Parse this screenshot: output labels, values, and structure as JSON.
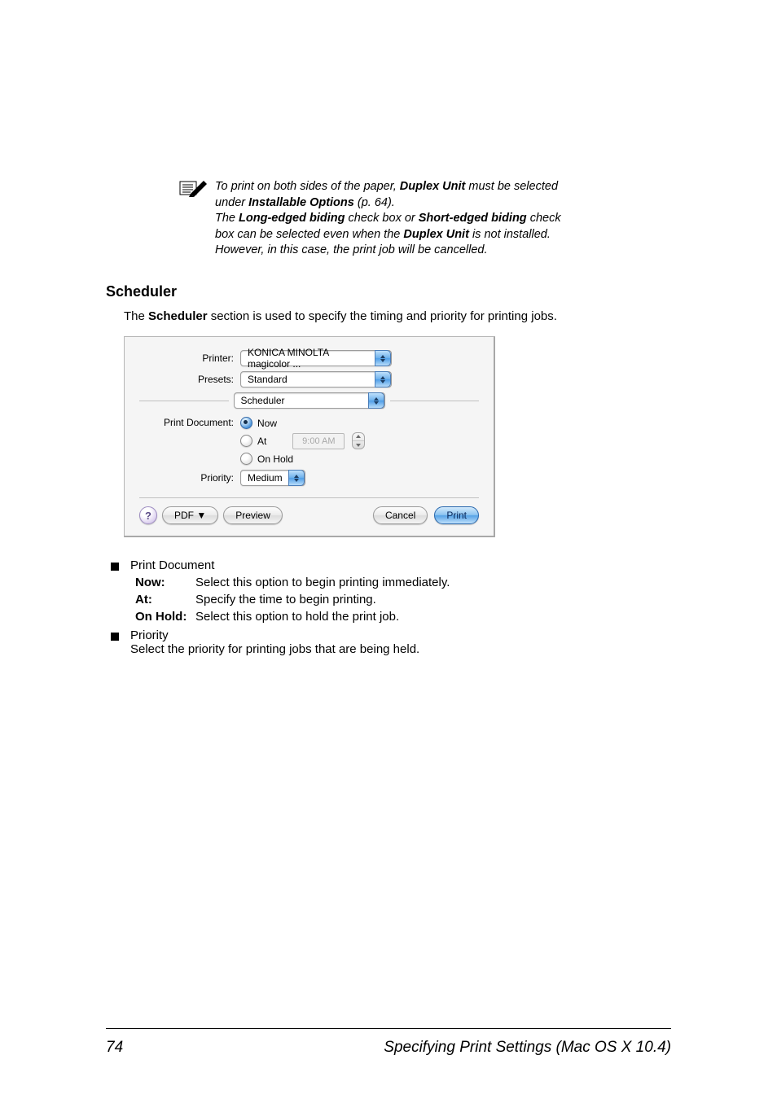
{
  "note": {
    "line1_pre": "To print on both sides of the paper, ",
    "duplex": "Duplex Unit",
    "line1_post": " must be selected under ",
    "installable": "Installable Options",
    "page_ref": " (p. 64).",
    "line2_pre": "The ",
    "long_edge": "Long-edged biding",
    "mid": " check box or ",
    "short_edge": "Short-edged biding",
    "line2_post": " check box can be selected even when the ",
    "line2_tail": " is not installed. However, in this case, the print job will be cancelled."
  },
  "heading": "Scheduler",
  "intro_pre": "The ",
  "intro_bold": "Scheduler",
  "intro_post": " section is used to specify the timing and priority for printing jobs.",
  "dialog": {
    "printer_label": "Printer:",
    "printer_value": "KONICA MINOLTA magicolor ...",
    "presets_label": "Presets:",
    "presets_value": "Standard",
    "pane_value": "Scheduler",
    "print_doc_label": "Print Document:",
    "opt_now": "Now",
    "opt_at": "At",
    "time_value": "9:00 AM",
    "opt_hold": "On Hold",
    "priority_label": "Priority:",
    "priority_value": "Medium",
    "help": "?",
    "pdf": "PDF ▼",
    "preview": "Preview",
    "cancel": "Cancel",
    "print": "Print"
  },
  "bullets": {
    "print_document": "Print Document",
    "now_term": "Now:",
    "now_desc": "Select this option to begin printing immediately.",
    "at_term": "At:",
    "at_desc": "Specify the time to begin printing.",
    "hold_term": "On Hold:",
    "hold_desc": "Select this option to hold the print job.",
    "priority": "Priority",
    "priority_desc": "Select the priority for printing jobs that are being held."
  },
  "footer": {
    "page": "74",
    "title": "Specifying Print Settings (Mac OS X 10.4)"
  }
}
